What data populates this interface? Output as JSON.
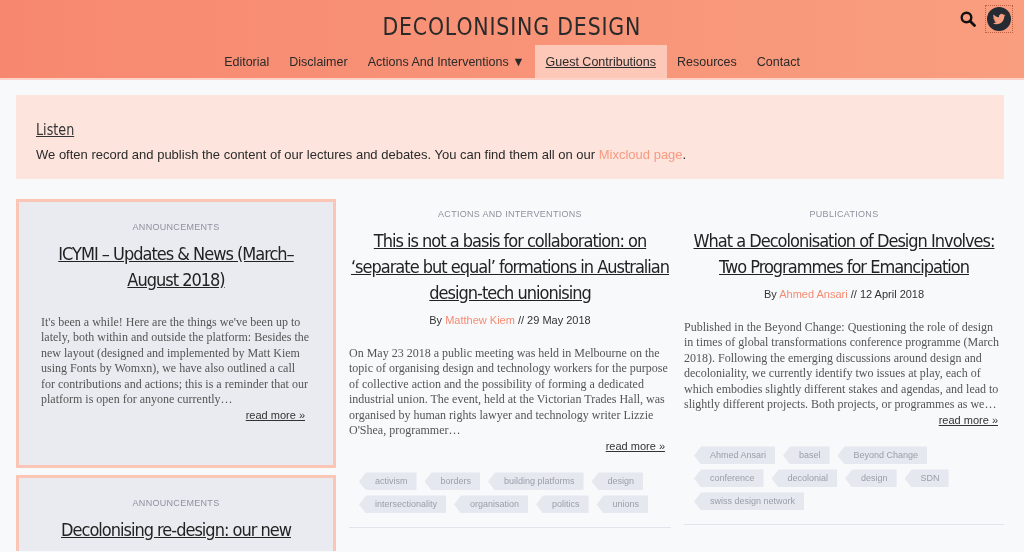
{
  "header": {
    "title": "DECOLONISING DESIGN",
    "nav": [
      {
        "label": "Editorial",
        "selected": false
      },
      {
        "label": "Disclaimer",
        "selected": false
      },
      {
        "label": "Actions And Interventions",
        "caret": "▼",
        "selected": false
      },
      {
        "label": "Guest Contributions",
        "selected": true
      },
      {
        "label": "Resources",
        "selected": false
      },
      {
        "label": "Contact",
        "selected": false
      }
    ]
  },
  "banner": {
    "heading": "Listen",
    "text_before": "We often record and publish the content of our lectures and debates. You can find them all on our ",
    "link": "Mixcloud page",
    "text_after": "."
  },
  "columns": [
    [
      {
        "featured": true,
        "category": "ANNOUNCEMENTS",
        "title": "ICYMI – Updates & News (March–August 2018)",
        "excerpt": "It's been a while! Here are the things we've been up to lately, both within and outside the platform: Besides the new layout (designed and implemented by Matt Kiem using Fonts by Womxn), we have also outlined a call for contributions and actions; this is a reminder that our platform is open for anyone currently…",
        "read_more": "read more »"
      },
      {
        "featured": true,
        "category": "ANNOUNCEMENTS",
        "title": "Decolonising re-design: our new"
      }
    ],
    [
      {
        "featured": false,
        "category": "ACTIONS AND INTERVENTIONS",
        "title": "This is not a basis for collaboration: on ‘separate but equal’ formations in Australian design-tech unionising",
        "by": "By",
        "author": "Matthew Kiem",
        "separator": "//",
        "date": "29 May 2018",
        "excerpt": "On May 23 2018 a public meeting was held in Melbourne on the topic of organising design and technology workers for the purpose of collective action and the possibility of forming a dedicated industrial union. The event, held at the Victorian Trades Hall, was organised by human rights lawyer and technology writer Lizzie O'Shea, programmer…",
        "read_more": "read more »",
        "tags": [
          "activism",
          "borders",
          "building platforms",
          "design",
          "intersectionality",
          "organisation",
          "politics",
          "unions"
        ]
      }
    ],
    [
      {
        "featured": false,
        "category": "PUBLICATIONS",
        "title": "What a Decolonisation of Design Involves: Two Programmes for Emancipation",
        "by": "By",
        "author": "Ahmed Ansari",
        "separator": "//",
        "date": "12 April 2018",
        "excerpt": "Published in the Beyond Change: Questioning the role of design in times of global transformations conference programme (March 2018). Following the emerging discussions around design and decoloniality, we currently identify two issues at play, each of which embodies slightly different stakes and agendas, and lead to slightly different projects. Both projects, or programmes as we…",
        "read_more": "read more »",
        "tags": [
          "Ahmed Ansari",
          "basel",
          "Beyond Change",
          "conference",
          "decolonial",
          "design",
          "SDN",
          "swiss design network"
        ]
      }
    ]
  ]
}
